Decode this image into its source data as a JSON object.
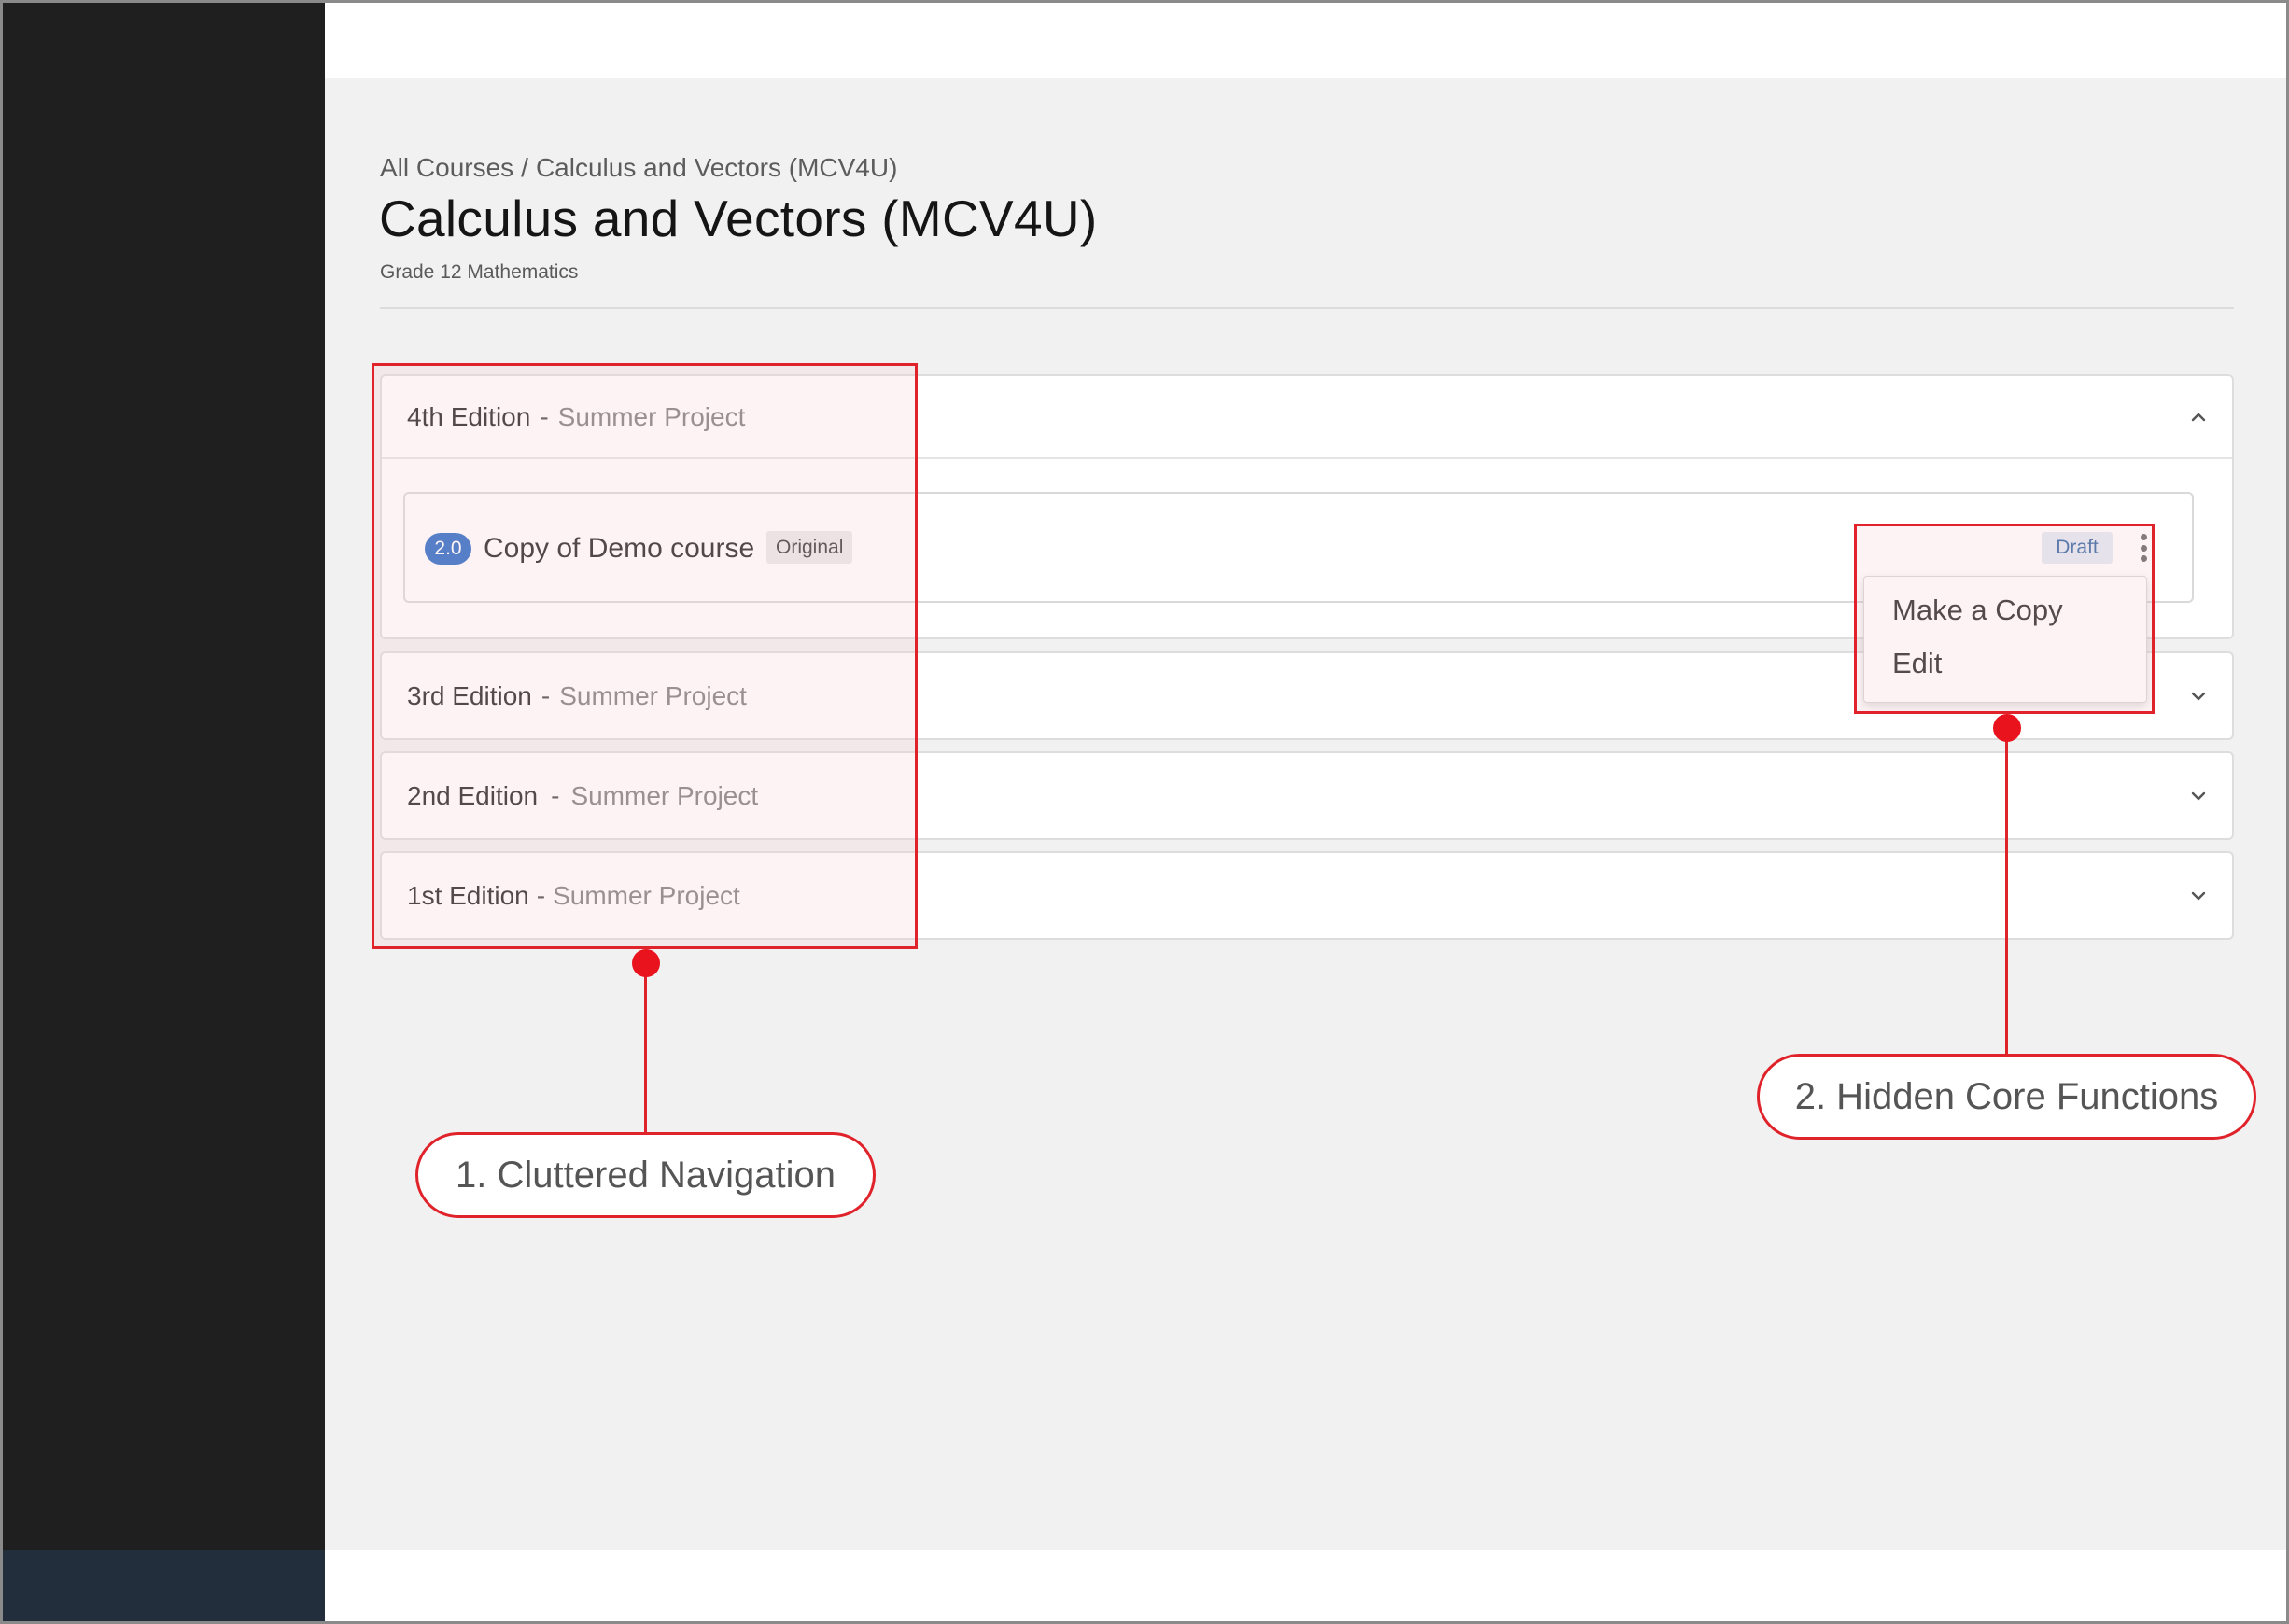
{
  "breadcrumb": {
    "root": "All Courses",
    "separator": "/",
    "current": "Calculus and Vectors (MCV4U)"
  },
  "page": {
    "title": "Calculus and Vectors (MCV4U)",
    "subtitle": "Grade 12 Mathematics"
  },
  "editions": [
    {
      "name": "4th Edition",
      "dash": "-",
      "type": "Summer Project",
      "expanded": true,
      "chevron": "chevron-up-icon"
    },
    {
      "name": "3rd Edition",
      "dash": "-",
      "type": "Summer Project",
      "expanded": false,
      "chevron": "chevron-down-icon"
    },
    {
      "name": "2nd Edition",
      "dash": "-",
      "type": "Summer Project",
      "expanded": false,
      "chevron": "chevron-down-icon"
    },
    {
      "name": "1st Edition",
      "dash": "-",
      "type": "Summer Project",
      "expanded": false,
      "chevron": "chevron-down-icon"
    }
  ],
  "course": {
    "version": "2.0",
    "name": "Copy of Demo course",
    "badge": "Original",
    "status": "Draft",
    "menu_icon": "kebab-menu-icon"
  },
  "menu": {
    "items": [
      "Make a Copy",
      "Edit"
    ]
  },
  "annotations": [
    {
      "label": "1. Cluttered Navigation"
    },
    {
      "label": "2. Hidden Core Functions"
    }
  ],
  "colors": {
    "annotation": "#e0232b",
    "version_badge": "#2165c4",
    "draft_text": "#2a5f9c",
    "sidebar": "#1f1f1f"
  }
}
